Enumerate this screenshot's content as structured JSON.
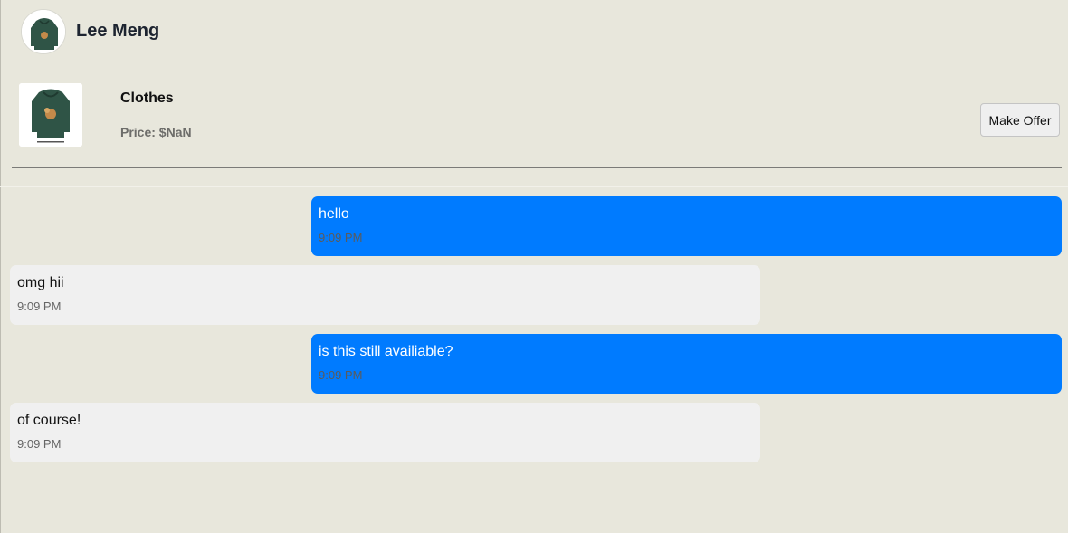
{
  "header": {
    "user_name": "Lee Meng"
  },
  "product": {
    "title": "Clothes",
    "price": "Price: $NaN",
    "make_offer_label": "Make Offer"
  },
  "messages": [
    {
      "direction": "sent",
      "text": "hello",
      "time": "9:09 PM"
    },
    {
      "direction": "received",
      "text": "omg hii",
      "time": "9:09 PM"
    },
    {
      "direction": "sent",
      "text": "is this still availiable?",
      "time": "9:09 PM"
    },
    {
      "direction": "received",
      "text": "of course!",
      "time": "9:09 PM"
    }
  ],
  "colors": {
    "background": "#e8e7dc",
    "sent_bubble": "#007bff",
    "received_bubble": "#f0f0f0",
    "hoodie": "#2f5446"
  }
}
